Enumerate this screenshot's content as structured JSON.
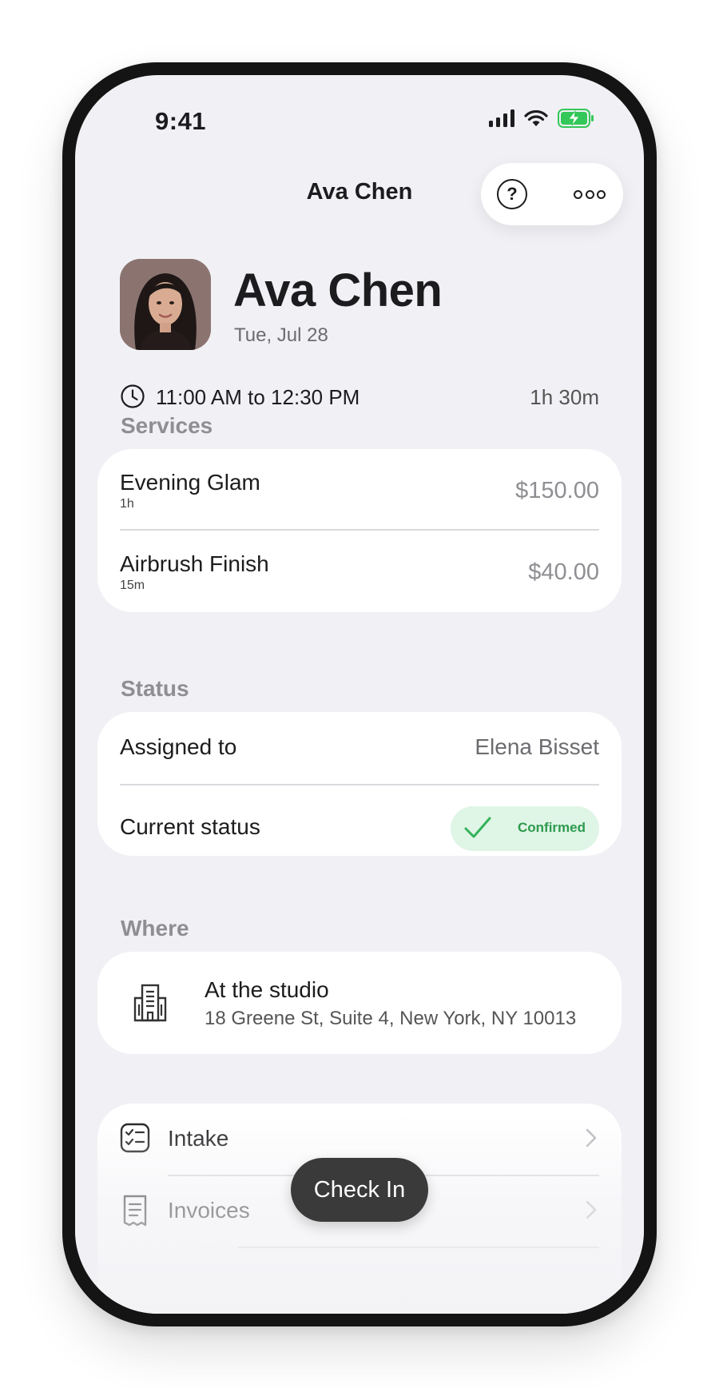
{
  "status_bar": {
    "time": "9:41",
    "icons": [
      "signal-icon",
      "wifi-icon",
      "battery-charging-icon"
    ],
    "battery_color": "#34c759"
  },
  "nav": {
    "title": "Ava Chen",
    "help_glyph": "?",
    "icons": [
      "help-icon",
      "more-icon"
    ]
  },
  "client": {
    "name": "Ava Chen",
    "date": "Tue, Jul 28",
    "time_range": "11:00 AM to 12:30 PM",
    "duration": "1h 30m"
  },
  "services": {
    "label": "Services",
    "items": [
      {
        "name": "Evening Glam",
        "duration": "1h",
        "price": "$150.00"
      },
      {
        "name": "Airbrush Finish",
        "duration": "15m",
        "price": "$40.00"
      }
    ]
  },
  "status": {
    "label": "Status",
    "assigned_label": "Assigned to",
    "assigned_value": "Elena Bisset",
    "current_label": "Current status",
    "current_value": "Confirmed",
    "badge_color": "#2e9a4e"
  },
  "where": {
    "label": "Where",
    "title": "At the studio",
    "address": "18 Greene St, Suite 4, New York, NY 10013"
  },
  "links": [
    {
      "label": "Intake",
      "icon": "checklist-icon"
    },
    {
      "label": "Invoices",
      "icon": "receipt-icon"
    }
  ],
  "cta": {
    "label": "Check In"
  }
}
